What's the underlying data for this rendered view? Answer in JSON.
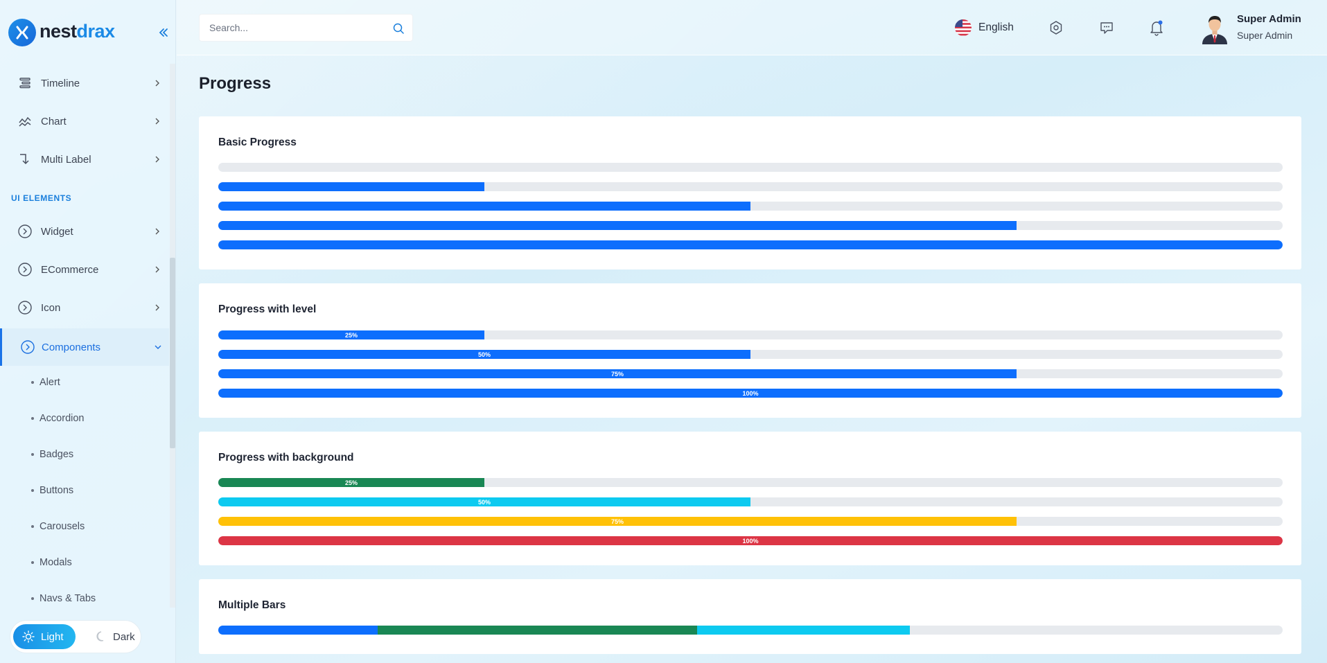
{
  "app": {
    "logo_text_a": "nest",
    "logo_text_b": "drax",
    "brand_color": "#1a8ae6"
  },
  "sidebar": {
    "items": [
      {
        "label": "Timeline",
        "icon": "timeline-icon"
      },
      {
        "label": "Chart",
        "icon": "chart-icon"
      },
      {
        "label": "Multi Label",
        "icon": "multilevel-icon"
      }
    ],
    "section_label": "UI ELEMENTS",
    "ui_items": [
      {
        "label": "Widget",
        "icon": "circle-arrow-icon"
      },
      {
        "label": "ECommerce",
        "icon": "circle-arrow-icon"
      },
      {
        "label": "Icon",
        "icon": "circle-arrow-icon"
      },
      {
        "label": "Components",
        "icon": "circle-arrow-icon",
        "active": true
      }
    ],
    "sub_items": [
      "Alert",
      "Accordion",
      "Badges",
      "Buttons",
      "Carousels",
      "Modals",
      "Navs & Tabs"
    ],
    "theme": {
      "light": "Light",
      "dark": "Dark",
      "selected": "Light"
    }
  },
  "header": {
    "search_placeholder": "Search...",
    "language": "English",
    "user_name": "Super Admin",
    "user_role": "Super Admin"
  },
  "main": {
    "page_title": "Progress",
    "basic": {
      "title": "Basic Progress",
      "values": [
        0,
        25,
        50,
        75,
        100
      ],
      "color": "#0d6efd"
    },
    "level": {
      "title": "Progress with level",
      "values": [
        25,
        50,
        75,
        100
      ],
      "labels": [
        "25%",
        "50%",
        "75%",
        "100%"
      ],
      "color": "#0d6efd"
    },
    "background": {
      "title": "Progress with background",
      "values": [
        25,
        50,
        75,
        100
      ],
      "labels": [
        "25%",
        "50%",
        "75%",
        "100%"
      ],
      "colors": [
        "#198754",
        "#0dcaf0",
        "#ffc107",
        "#dc3545"
      ]
    },
    "multiple": {
      "title": "Multiple Bars",
      "segments": [
        {
          "value": 15,
          "color": "#0d6efd"
        },
        {
          "value": 30,
          "color": "#198754"
        },
        {
          "value": 20,
          "color": "#0dcaf0"
        }
      ]
    }
  }
}
